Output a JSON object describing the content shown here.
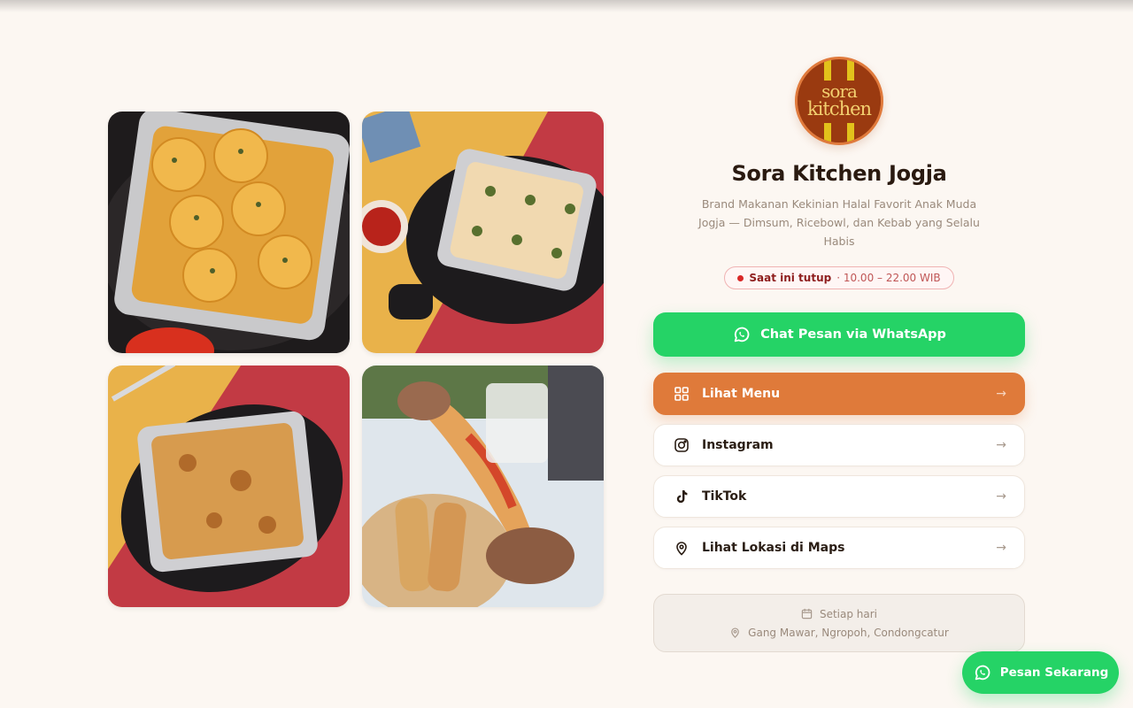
{
  "brand": {
    "logo_line1": "sora",
    "logo_line2": "kitchen",
    "title": "Sora Kitchen Jogja",
    "description": "Brand Makanan Kekinian Halal Favorit Anak Muda Jogja — Dimsum, Ricebowl, dan Kebab yang Selalu Habis"
  },
  "status": {
    "label": "Saat ini tutup",
    "hours": "· 10.00 – 22.00 WIB"
  },
  "whatsapp_button": {
    "label": "Chat Pesan via WhatsApp",
    "icon": "whatsapp-icon"
  },
  "links": [
    {
      "label": "Lihat Menu",
      "icon": "grid-icon"
    },
    {
      "label": "Instagram",
      "icon": "instagram-icon"
    },
    {
      "label": "TikTok",
      "icon": "tiktok-icon"
    },
    {
      "label": "Lihat Lokasi di Maps",
      "icon": "map-pin-icon"
    }
  ],
  "info": {
    "schedule": "Setiap hari",
    "address": "Gang Mawar, Ngropoh, Condongcatur"
  },
  "floating_button": {
    "label": "Pesan Sekarang",
    "icon": "whatsapp-icon"
  },
  "colors": {
    "background": "#fcf7f2",
    "whatsapp_green": "#25d366",
    "accent_orange": "#df7a3a",
    "status_red": "#d92727"
  }
}
